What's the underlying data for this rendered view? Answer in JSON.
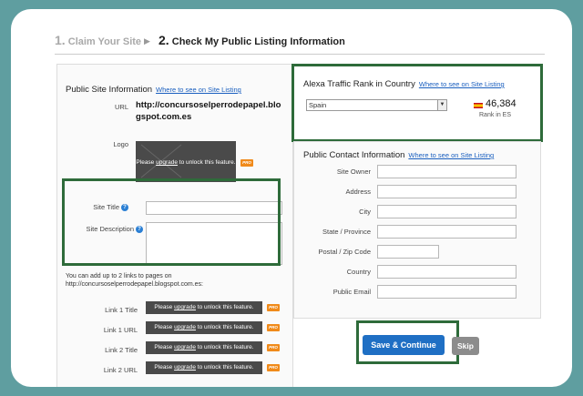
{
  "steps": {
    "step1_num": "1.",
    "step1_label": "Claim Your Site",
    "step2_num": "2.",
    "step2_label": "Check My Public Listing Information"
  },
  "public_site": {
    "title": "Public Site Information",
    "where_link": "Where to see on Site Listing",
    "url_label": "URL",
    "url_value_line1": "http://concursoselperrodepapel.blo",
    "url_value_line2": "gspot.com.es",
    "logo_label": "Logo",
    "logo_upgrade_pre": "Please ",
    "logo_upgrade_link": "upgrade",
    "logo_upgrade_post": " to unlock this feature.",
    "site_title_label": "Site Title",
    "site_description_label": "Site Description",
    "site_title_value": "",
    "site_description_value": "",
    "links_note_line1": "You can add up to 2 links to pages on",
    "links_note_line2": "http://concursoselperrodepapel.blogspot.com.es:",
    "links": [
      {
        "label": "Link 1 Title"
      },
      {
        "label": "Link 1 URL"
      },
      {
        "label": "Link 2 Title"
      },
      {
        "label": "Link 2 URL"
      }
    ],
    "link_upgrade_pre": "Please ",
    "link_upgrade_link": "upgrade",
    "link_upgrade_post": " to unlock this feature.",
    "pro_badge": "PRO"
  },
  "alexa": {
    "title": "Alexa Traffic Rank in Country",
    "where_link": "Where to see on Site Listing",
    "country_selected": "Spain",
    "rank_value": "46,384",
    "rank_caption": "Rank in ES"
  },
  "contact": {
    "title": "Public Contact Information",
    "where_link": "Where to see on Site Listing",
    "fields": [
      {
        "label": "Site Owner",
        "value": ""
      },
      {
        "label": "Address",
        "value": ""
      },
      {
        "label": "City",
        "value": ""
      },
      {
        "label": "State / Province",
        "value": ""
      },
      {
        "label": "Postal / Zip Code",
        "value": ""
      },
      {
        "label": "Country",
        "value": ""
      },
      {
        "label": "Public Email",
        "value": ""
      }
    ]
  },
  "actions": {
    "save_label": "Save & Continue",
    "skip_label": "Skip"
  },
  "colors": {
    "background": "#5f9ea0",
    "highlight": "#2e6b3a",
    "primary_button": "#1f6fc4",
    "pro_badge": "#f08a1a"
  }
}
